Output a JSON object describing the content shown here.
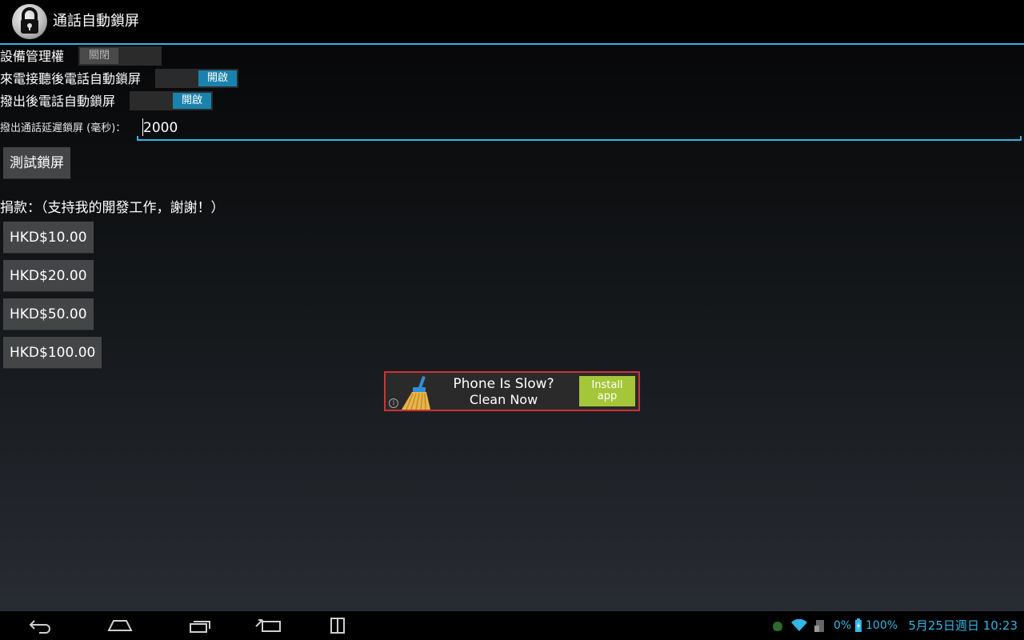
{
  "app": {
    "title": "通話自動鎖屏",
    "icon": "padlock-icon"
  },
  "settings": {
    "device_admin": {
      "label": "設備管理權",
      "state": "關閉"
    },
    "incoming": {
      "label": "來電接聽後電話自動鎖屏",
      "state": "開啟"
    },
    "outgoing": {
      "label": "撥出後電話自動鎖屏",
      "state": "開啟"
    },
    "delay": {
      "label": "撥出通話延遲鎖屏 (毫秒)：",
      "value": "2000"
    },
    "test_button": "測試鎖屏"
  },
  "donate": {
    "label": "捐款：（支持我的開發工作，謝謝！）",
    "amounts": [
      "HKD$10.00",
      "HKD$20.00",
      "HKD$50.00",
      "HKD$100.00"
    ]
  },
  "ad": {
    "line1": "Phone Is Slow?",
    "line2": "Clean Now",
    "install_line1": "Install",
    "install_line2": "app",
    "info": "i"
  },
  "status_bar": {
    "signal": "0%",
    "battery": "100%",
    "date": "5月25日週日",
    "time": "10:23"
  },
  "colors": {
    "accent": "#33b5e5",
    "toggle_on": "#1a82ad",
    "ad_border": "#cc3333",
    "install_green": "#a4c639"
  }
}
